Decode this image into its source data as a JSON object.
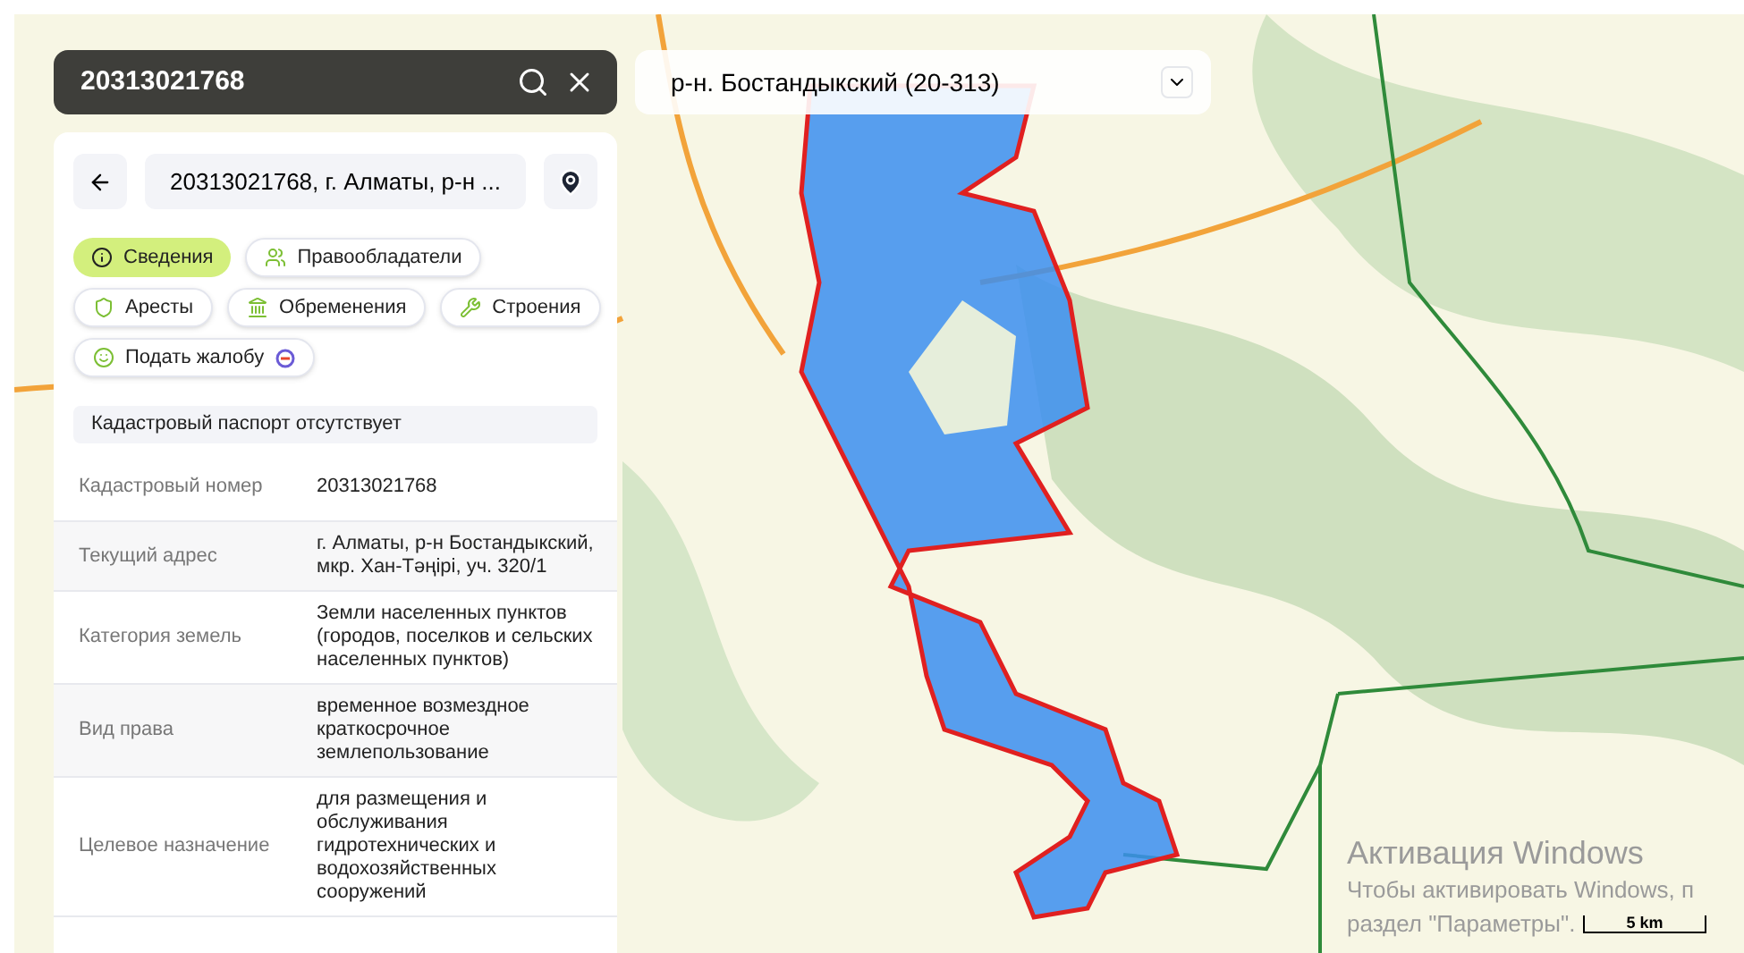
{
  "search": {
    "value": "20313021768"
  },
  "district_select": {
    "value": "р-н. Бостандыкский (20-313)"
  },
  "card": {
    "title": "20313021768, г. Алматы, р-н ...",
    "tabs": [
      {
        "label": "Сведения",
        "selected": true
      },
      {
        "label": "Правообладатели",
        "selected": false
      },
      {
        "label": "Аресты",
        "selected": false
      },
      {
        "label": "Обременения",
        "selected": false
      },
      {
        "label": "Строения",
        "selected": false
      },
      {
        "label": "Подать жалобу",
        "selected": false
      }
    ],
    "notice": "Кадастровый паспорт отсутствует",
    "rows": [
      {
        "label": "Кадастровый номер",
        "value": "20313021768"
      },
      {
        "label": "Текущий адрес",
        "value": "г. Алматы, р-н Бостандыкский, мкр. Хан-Тәңірі, уч. 320/1"
      },
      {
        "label": "Категория земель",
        "value": "Земли населенных пунктов (городов, поселков и сельских населенных пунктов)"
      },
      {
        "label": "Вид права",
        "value": "временное возмездное краткосрочное землепользование"
      },
      {
        "label": "Целевое назначение",
        "value": "для размещения и обслуживания гидротехнических и водохозяйственных сооружений"
      }
    ]
  },
  "scale": {
    "label": "5 km"
  },
  "windows_activation": {
    "title": "Активация Windows",
    "text": "Чтобы активировать Windows, п",
    "text_2": "раздел \"Параметры\"."
  }
}
